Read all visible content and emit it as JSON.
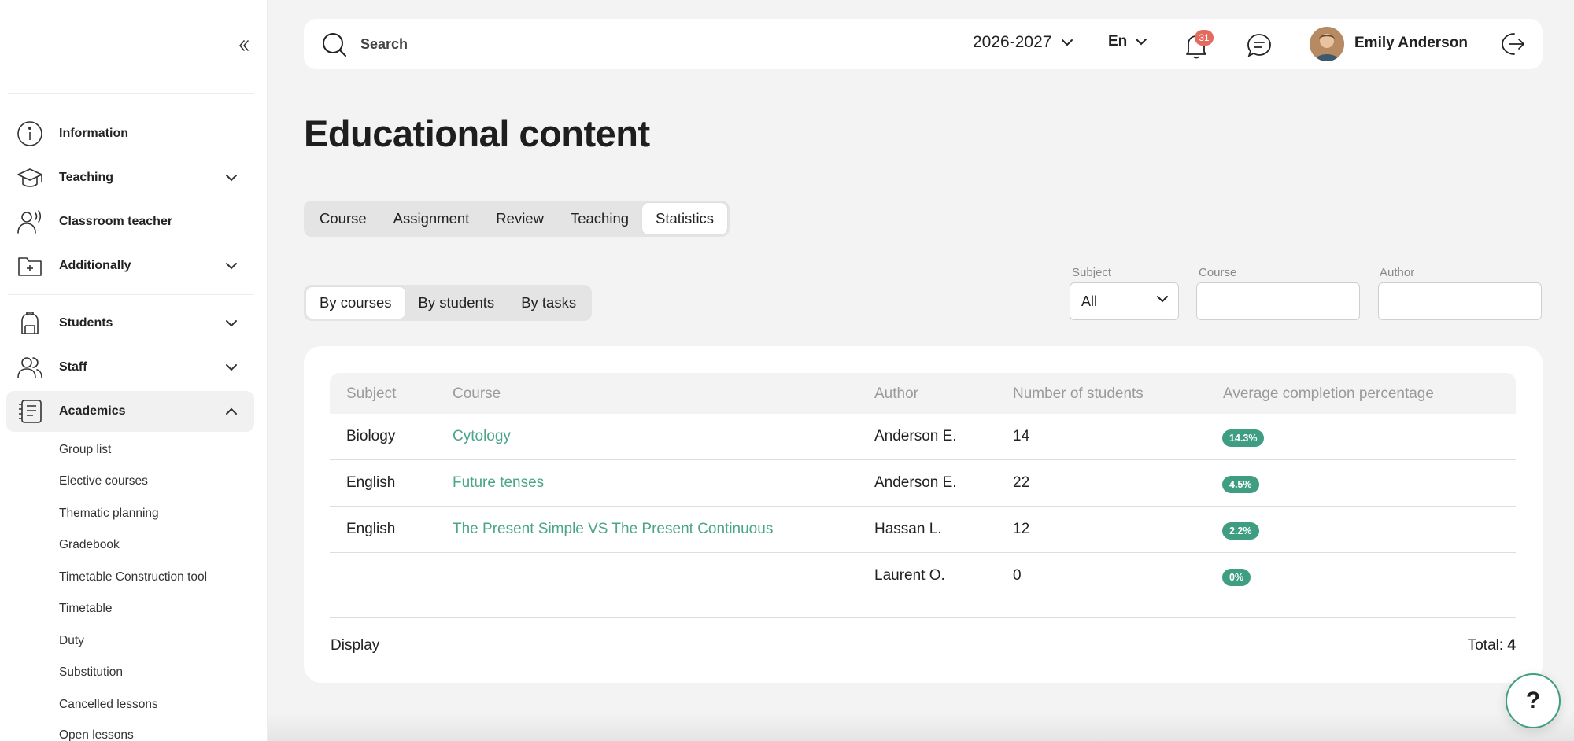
{
  "sidebar": {
    "collapse_icon": "double-chevron-left-icon",
    "items": [
      {
        "label": "Information",
        "icon": "info-icon"
      },
      {
        "label": "Teaching",
        "icon": "graduation-cap-icon"
      },
      {
        "label": "Classroom teacher",
        "icon": "teacher-voice-icon"
      },
      {
        "label": "Additionally",
        "icon": "folder-plus-icon"
      },
      {
        "label": "Students",
        "icon": "backpack-icon"
      },
      {
        "label": "Staff",
        "icon": "users-icon"
      },
      {
        "label": "Academics",
        "icon": "journal-icon"
      }
    ],
    "academics_subitems": [
      "Group list",
      "Elective courses",
      "Thematic planning",
      "Gradebook",
      "Timetable Construction tool",
      "Timetable",
      "Duty",
      "Substitution",
      "Cancelled lessons",
      "Open lessons"
    ]
  },
  "topbar": {
    "search_placeholder": "Search",
    "academic_year": "2026-2027",
    "language": "En",
    "notification_count": "31",
    "user_name": "Emily Anderson"
  },
  "page": {
    "title": "Educational content",
    "tabs": [
      "Course",
      "Assignment",
      "Review",
      "Teaching",
      "Statistics"
    ],
    "active_tab": "Statistics",
    "subtabs": [
      "By courses",
      "By students",
      "By tasks"
    ],
    "active_subtab": "By courses"
  },
  "filters": {
    "subject_label": "Subject",
    "subject_value": "All",
    "course_label": "Course",
    "course_value": "",
    "author_label": "Author",
    "author_value": ""
  },
  "table": {
    "columns": [
      "Subject",
      "Course",
      "Author",
      "Number of students",
      "Average completion percentage"
    ],
    "rows": [
      {
        "subject": "Biology",
        "course": "Cytology",
        "author": "Anderson E.",
        "students": "14",
        "completion": "14.3%"
      },
      {
        "subject": "English",
        "course": "Future tenses",
        "author": "Anderson E.",
        "students": "22",
        "completion": "4.5%"
      },
      {
        "subject": "English",
        "course": "The Present Simple VS The Present Continuous",
        "author": "Hassan L.",
        "students": "12",
        "completion": "2.2%"
      },
      {
        "subject": "",
        "course": "",
        "author": "Laurent O.",
        "students": "0",
        "completion": "0%"
      }
    ],
    "display_label": "Display",
    "total_label": "Total:",
    "total_value": "4"
  },
  "help_label": "?",
  "colors": {
    "accent": "#3f9e82",
    "link": "#4aa58a",
    "badge": "#e36b5e"
  }
}
